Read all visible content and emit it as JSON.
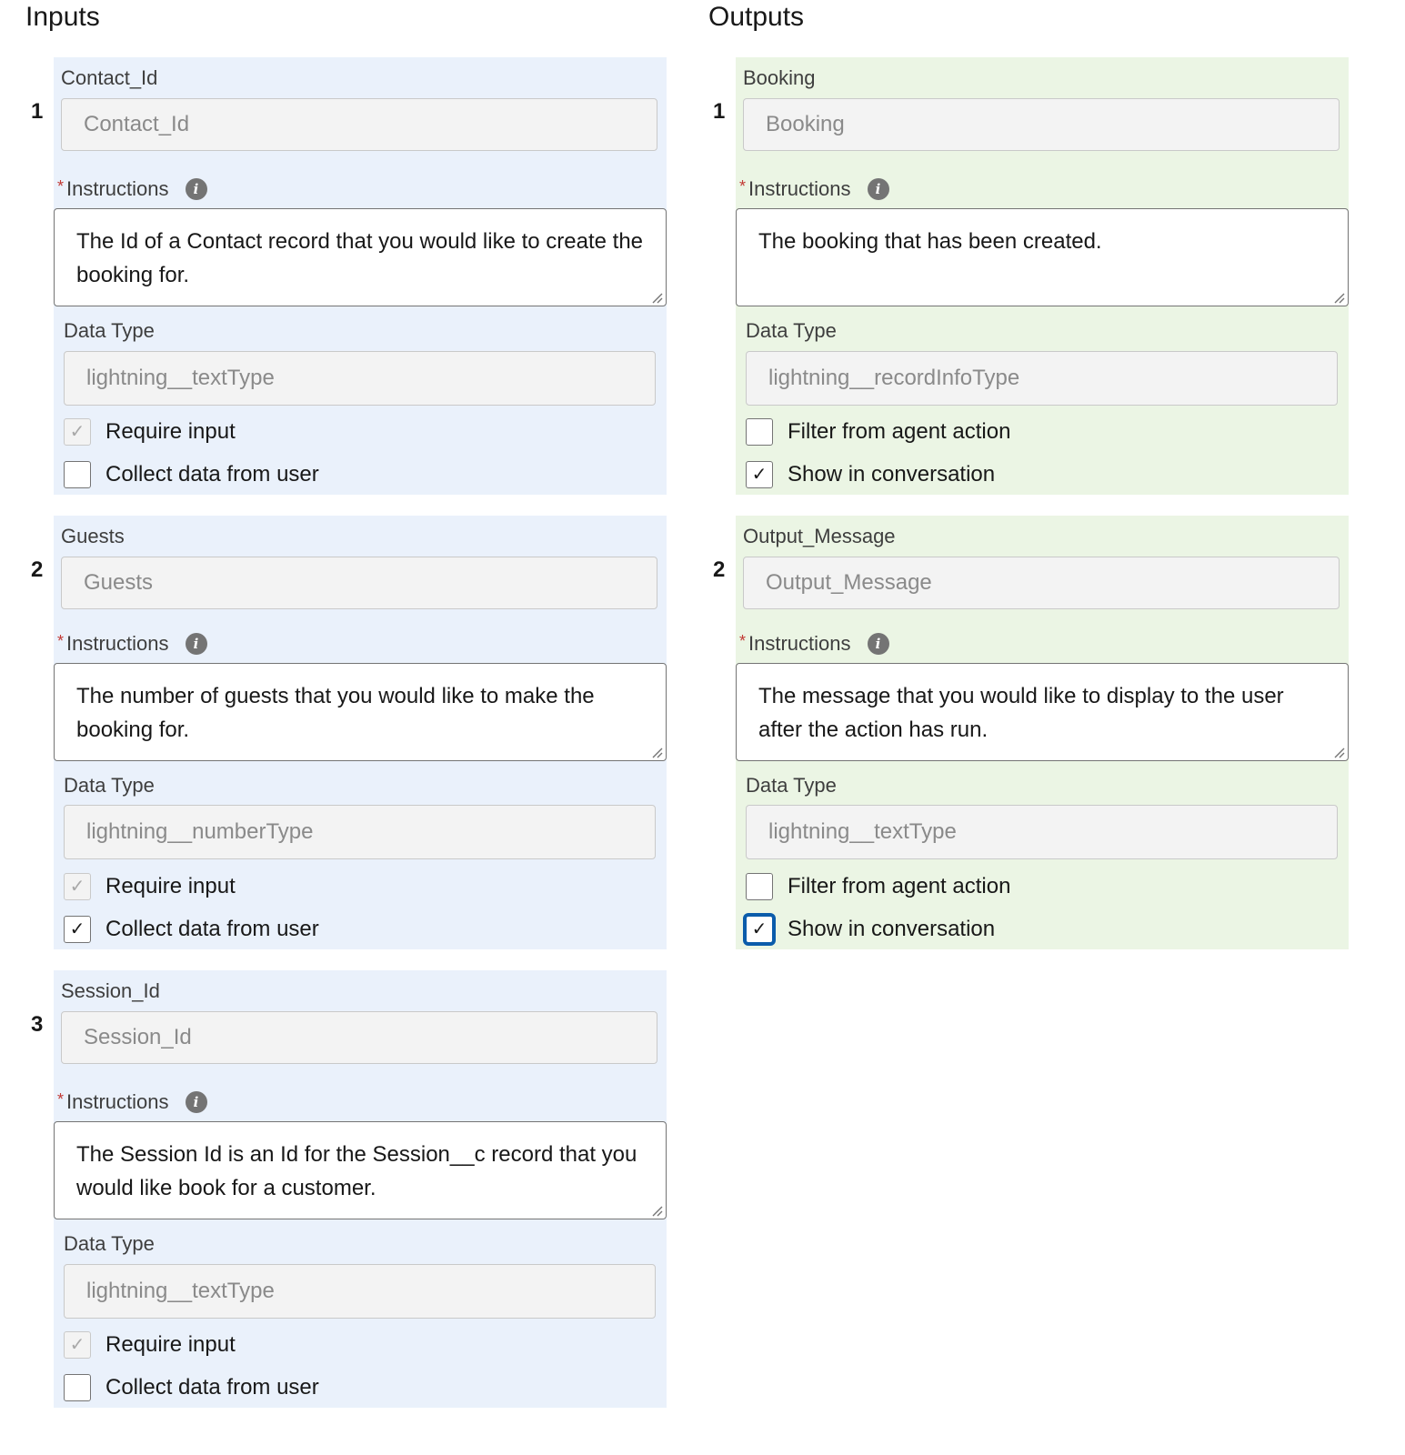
{
  "inputs": {
    "heading": "Inputs",
    "items": [
      {
        "index": "1",
        "label": "Contact_Id",
        "name_value": "Contact_Id",
        "instructions_label": "Instructions",
        "instructions_text": "The Id of a Contact record that you would like to create the booking for.",
        "data_type_label": "Data Type",
        "data_type_value": "lightning__textType",
        "checkbox1": {
          "label": "Require input",
          "checked": true,
          "disabled": true
        },
        "checkbox2": {
          "label": "Collect data from user",
          "checked": false,
          "disabled": false
        }
      },
      {
        "index": "2",
        "label": "Guests",
        "name_value": "Guests",
        "instructions_label": "Instructions",
        "instructions_text": "The number of guests that you would like to make the booking for.",
        "data_type_label": "Data Type",
        "data_type_value": "lightning__numberType",
        "checkbox1": {
          "label": "Require input",
          "checked": true,
          "disabled": true
        },
        "checkbox2": {
          "label": "Collect data from user",
          "checked": true,
          "disabled": false
        }
      },
      {
        "index": "3",
        "label": "Session_Id",
        "name_value": "Session_Id",
        "instructions_label": "Instructions",
        "instructions_text": "The Session Id is an Id for the Session__c record that you would like book for a customer.",
        "data_type_label": "Data Type",
        "data_type_value": "lightning__textType",
        "checkbox1": {
          "label": "Require input",
          "checked": true,
          "disabled": true
        },
        "checkbox2": {
          "label": "Collect data from user",
          "checked": false,
          "disabled": false
        }
      }
    ]
  },
  "outputs": {
    "heading": "Outputs",
    "items": [
      {
        "index": "1",
        "label": "Booking",
        "name_value": "Booking",
        "instructions_label": "Instructions",
        "instructions_text": "The booking that has been created.",
        "data_type_label": "Data Type",
        "data_type_value": "lightning__recordInfoType",
        "checkbox1": {
          "label": "Filter from agent action",
          "checked": false,
          "disabled": false
        },
        "checkbox2": {
          "label": "Show in conversation",
          "checked": true,
          "disabled": false
        }
      },
      {
        "index": "2",
        "label": "Output_Message",
        "name_value": "Output_Message",
        "instructions_label": "Instructions",
        "instructions_text": "The message that you would like to display to the user after the action has run.",
        "data_type_label": "Data Type",
        "data_type_value": "lightning__textType",
        "checkbox1": {
          "label": "Filter from agent action",
          "checked": false,
          "disabled": false
        },
        "checkbox2": {
          "label": "Show in conversation",
          "checked": true,
          "disabled": false,
          "focused": true
        }
      }
    ]
  },
  "icons": {
    "info": "info-icon",
    "check": "checkmark-icon",
    "resize": "resize-grip-icon"
  },
  "colors": {
    "input_panel_bg": "#eaf1fb",
    "output_panel_bg": "#ebf5e4",
    "required_star": "#c23934",
    "focus_ring": "#0b5cab"
  },
  "glyphs": {
    "required_star": "*",
    "info": "i",
    "check": "✓"
  }
}
